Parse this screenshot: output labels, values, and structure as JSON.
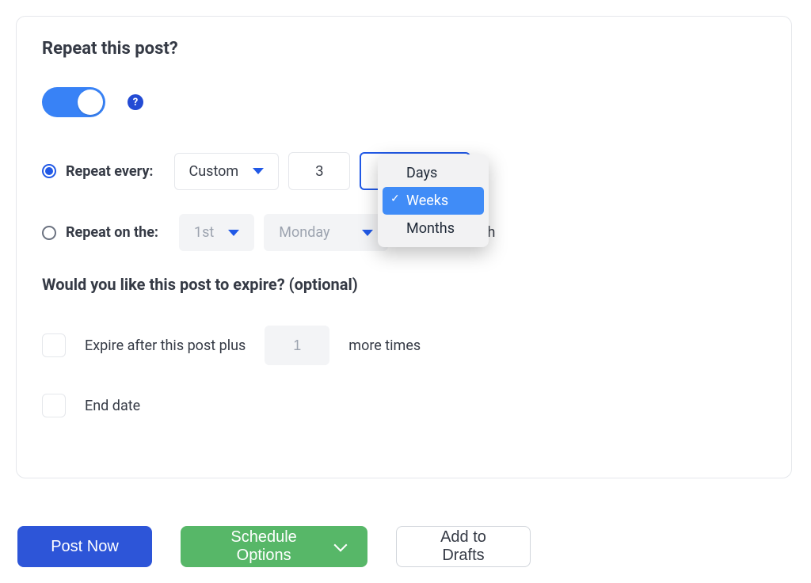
{
  "heading": "Repeat this post?",
  "toggle_on": true,
  "help_icon": "?",
  "repeat_every": {
    "label": "Repeat every:",
    "preset": "Custom",
    "count": "3",
    "unit_options": [
      "Days",
      "Weeks",
      "Months"
    ],
    "unit_selected": "Weeks"
  },
  "repeat_on": {
    "label": "Repeat on the:",
    "ordinal": "1st",
    "weekday": "Monday",
    "suffix": "of each month"
  },
  "expire": {
    "heading": "Would you like this post to expire? (optional)",
    "after_label_pre": "Expire after this post plus",
    "after_count": "1",
    "after_label_post": "more times",
    "end_date_label": "End date"
  },
  "actions": {
    "post_now": "Post Now",
    "schedule": "Schedule Options",
    "drafts": "Add to Drafts"
  }
}
